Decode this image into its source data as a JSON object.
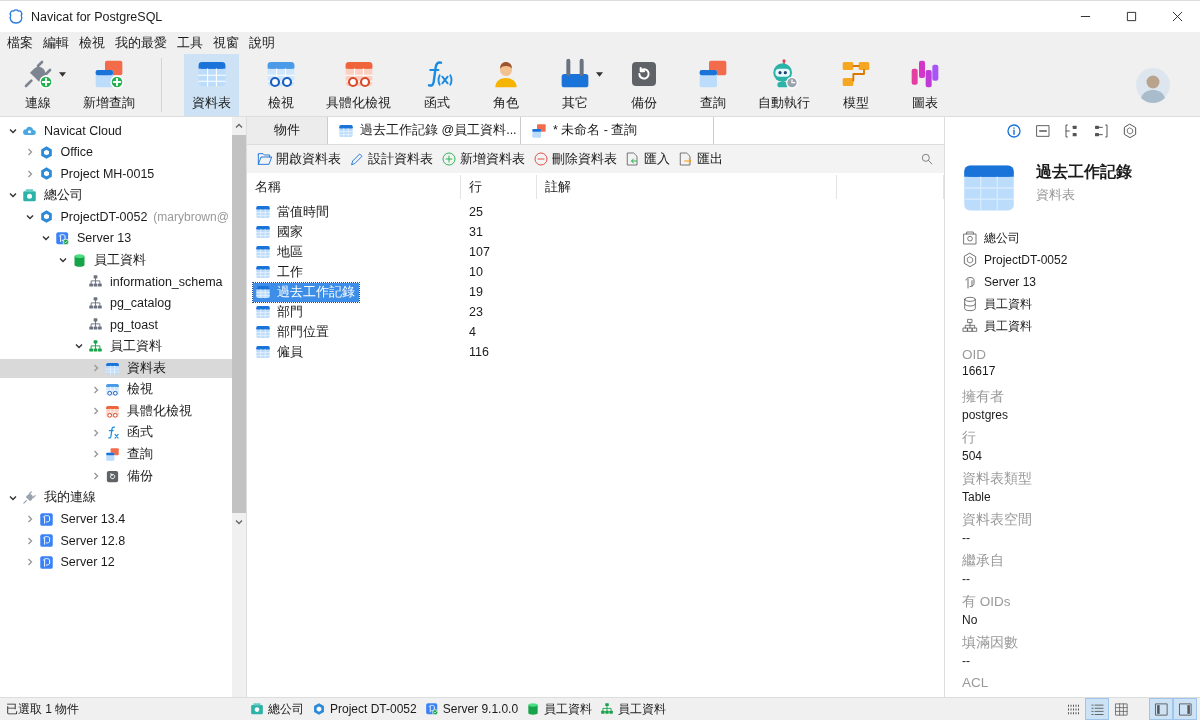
{
  "window": {
    "title": "Navicat for PostgreSQL"
  },
  "menu": [
    "檔案",
    "編輯",
    "檢視",
    "我的最愛",
    "工具",
    "視窗",
    "說明"
  ],
  "toolbar": {
    "groups": [
      {
        "buttons": [
          {
            "label": "連線",
            "kind": "connect",
            "selected": false,
            "dropdown": true
          },
          {
            "label": "新增查詢",
            "kind": "newquery",
            "selected": false,
            "dropdown": false
          }
        ]
      },
      {
        "buttons": [
          {
            "label": "資料表",
            "kind": "table",
            "selected": true,
            "dropdown": false
          },
          {
            "label": "檢視",
            "kind": "view",
            "selected": false,
            "dropdown": false
          },
          {
            "label": "具體化檢視",
            "kind": "matview",
            "selected": false,
            "dropdown": false
          },
          {
            "label": "函式",
            "kind": "func",
            "selected": false,
            "dropdown": false
          },
          {
            "label": "角色",
            "kind": "role",
            "selected": false,
            "dropdown": false
          },
          {
            "label": "其它",
            "kind": "tools",
            "selected": false,
            "dropdown": true
          },
          {
            "label": "備份",
            "kind": "backup",
            "selected": false,
            "dropdown": false
          },
          {
            "label": "查詢",
            "kind": "query",
            "selected": false,
            "dropdown": false
          },
          {
            "label": "自動執行",
            "kind": "robot",
            "selected": false,
            "dropdown": false
          },
          {
            "label": "模型",
            "kind": "model",
            "selected": false,
            "dropdown": false
          },
          {
            "label": "圖表",
            "kind": "chart",
            "selected": false,
            "dropdown": false
          }
        ]
      }
    ]
  },
  "tree": [
    {
      "label": "Navicat Cloud",
      "kind": "cloud",
      "expanded": true,
      "selected": false,
      "children": [
        {
          "label": "Office",
          "kind": "project",
          "expanded": false,
          "selected": false
        },
        {
          "label": "Project MH-0015",
          "kind": "project",
          "expanded": false,
          "selected": false
        }
      ]
    },
    {
      "label": "總公司",
      "kind": "company",
      "expanded": true,
      "selected": false,
      "children": [
        {
          "label": "ProjectDT-0052",
          "note": "(marybrown@",
          "kind": "project",
          "expanded": true,
          "selected": false,
          "children": [
            {
              "label": "Server 13",
              "kind": "server",
              "expanded": true,
              "selected": false,
              "children": [
                {
                  "label": "員工資料",
                  "kind": "database",
                  "expanded": true,
                  "selected": false,
                  "children": [
                    {
                      "label": "information_schema",
                      "kind": "schema",
                      "selected": false
                    },
                    {
                      "label": "pg_catalog",
                      "kind": "schema",
                      "selected": false
                    },
                    {
                      "label": "pg_toast",
                      "kind": "schema",
                      "selected": false
                    },
                    {
                      "label": "員工資料",
                      "kind": "schema-active",
                      "expanded": true,
                      "selected": false,
                      "children": [
                        {
                          "label": "資料表",
                          "kind": "table",
                          "expanded": false,
                          "selected": true
                        },
                        {
                          "label": "檢視",
                          "kind": "view",
                          "expanded": false,
                          "selected": false
                        },
                        {
                          "label": "具體化檢視",
                          "kind": "matview",
                          "expanded": false,
                          "selected": false
                        },
                        {
                          "label": "函式",
                          "kind": "fx",
                          "expanded": false,
                          "selected": false
                        },
                        {
                          "label": "查詢",
                          "kind": "query",
                          "expanded": false,
                          "selected": false
                        },
                        {
                          "label": "備份",
                          "kind": "backup",
                          "expanded": false,
                          "selected": false
                        }
                      ]
                    }
                  ]
                }
              ]
            }
          ]
        }
      ]
    },
    {
      "label": "我的連線",
      "kind": "plug",
      "expanded": true,
      "selected": false,
      "children": [
        {
          "label": "Server 13.4",
          "kind": "pg",
          "expanded": false,
          "selected": false
        },
        {
          "label": "Server 12.8",
          "kind": "pg",
          "expanded": false,
          "selected": false
        },
        {
          "label": "Server 12",
          "kind": "pg",
          "expanded": false,
          "selected": false
        }
      ]
    }
  ],
  "tabs": [
    {
      "label": "物件",
      "selected": true
    },
    {
      "label": "過去工作記錄 @員工資料...",
      "kind": "table",
      "selected": false
    },
    {
      "label": "* 未命名 - 查詢",
      "kind": "query",
      "selected": false
    }
  ],
  "actions": [
    {
      "label": "開啟資料表",
      "kind": "open"
    },
    {
      "label": "設計資料表",
      "kind": "design"
    },
    {
      "label": "新增資料表",
      "kind": "add"
    },
    {
      "label": "刪除資料表",
      "kind": "delete"
    },
    {
      "label": "匯入",
      "kind": "import"
    },
    {
      "label": "匯出",
      "kind": "export"
    }
  ],
  "table": {
    "columns": [
      "名稱",
      "行",
      "註解"
    ],
    "rows": [
      {
        "name": "當值時間",
        "rows": "25",
        "selected": false
      },
      {
        "name": "國家",
        "rows": "31",
        "selected": false
      },
      {
        "name": "地區",
        "rows": "107",
        "selected": false
      },
      {
        "name": "工作",
        "rows": "10",
        "selected": false
      },
      {
        "name": "過去工作記錄",
        "rows": "19",
        "selected": true
      },
      {
        "name": "部門",
        "rows": "23",
        "selected": false
      },
      {
        "name": "部門位置",
        "rows": "4",
        "selected": false
      },
      {
        "name": "僱員",
        "rows": "116",
        "selected": false
      }
    ]
  },
  "info_panel": {
    "tabs": [
      {
        "kind": "info",
        "selected": true
      },
      {
        "kind": "ddl",
        "selected": false
      },
      {
        "kind": "deps",
        "selected": false
      },
      {
        "kind": "deps2",
        "selected": false
      },
      {
        "kind": "hexagon",
        "selected": false
      }
    ],
    "title": "過去工作記錄",
    "subtitle": "資料表",
    "path": [
      {
        "label": "總公司",
        "kind": "company"
      },
      {
        "label": "ProjectDT-0052",
        "kind": "project"
      },
      {
        "label": "Server 13",
        "kind": "server"
      },
      {
        "label": "員工資料",
        "kind": "database"
      },
      {
        "label": "員工資料",
        "kind": "schema"
      }
    ],
    "properties": [
      {
        "label": "OID",
        "value": "16617"
      },
      {
        "label": "擁有者",
        "value": "postgres"
      },
      {
        "label": "行",
        "value": "504"
      },
      {
        "label": "資料表類型",
        "value": "Table"
      },
      {
        "label": "資料表空間",
        "value": "--"
      },
      {
        "label": "繼承自",
        "value": "--"
      },
      {
        "label": "有 OIDs",
        "value": "No"
      },
      {
        "label": "填滿因數",
        "value": "--"
      },
      {
        "label": "ACL"
      }
    ]
  },
  "status_bar": {
    "text": "已選取 1 物件",
    "path": [
      {
        "label": "總公司",
        "kind": "company"
      },
      {
        "label": "Project DT-0052",
        "kind": "project"
      },
      {
        "label": "Server 9.1.0.0",
        "kind": "server"
      },
      {
        "label": "員工資料",
        "kind": "database"
      },
      {
        "label": "員工資料",
        "kind": "schema-active"
      }
    ],
    "views": [
      {
        "kind": "grid-small",
        "selected": false
      },
      {
        "kind": "list",
        "selected": true
      },
      {
        "kind": "grid-large",
        "selected": false
      }
    ],
    "panes": [
      {
        "kind": "left-pane",
        "selected": true
      },
      {
        "kind": "right-pane",
        "selected": true
      }
    ]
  }
}
